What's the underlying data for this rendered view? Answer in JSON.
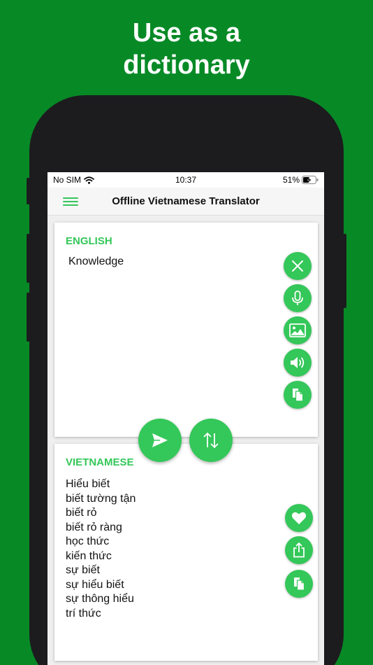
{
  "headline": {
    "line1": "Use as a",
    "line2": "dictionary"
  },
  "status_bar": {
    "carrier": "No SIM",
    "time": "10:37",
    "battery": "51%"
  },
  "nav": {
    "title": "Offline Vietnamese Translator"
  },
  "source": {
    "language": "ENGLISH",
    "text": "Knowledge"
  },
  "target": {
    "language": "VIETNAMESE",
    "results": [
      "Hiểu biết",
      "biết tường tận",
      "biết rỏ",
      "biết rỏ ràng",
      "học thức",
      "kiến thức",
      "sự biết",
      "sự hiểu biết",
      "sự thông hiểu",
      "trí thức"
    ]
  },
  "colors": {
    "background": "#078a26",
    "accent": "#34c759",
    "phone_frame": "#1c1c1e"
  },
  "icons": {
    "source_actions": [
      "close-icon",
      "microphone-icon",
      "image-icon",
      "speaker-icon",
      "copy-icon"
    ],
    "center_actions": [
      "send-icon",
      "swap-icon"
    ],
    "target_actions": [
      "heart-icon",
      "share-icon",
      "copy-icon"
    ]
  }
}
